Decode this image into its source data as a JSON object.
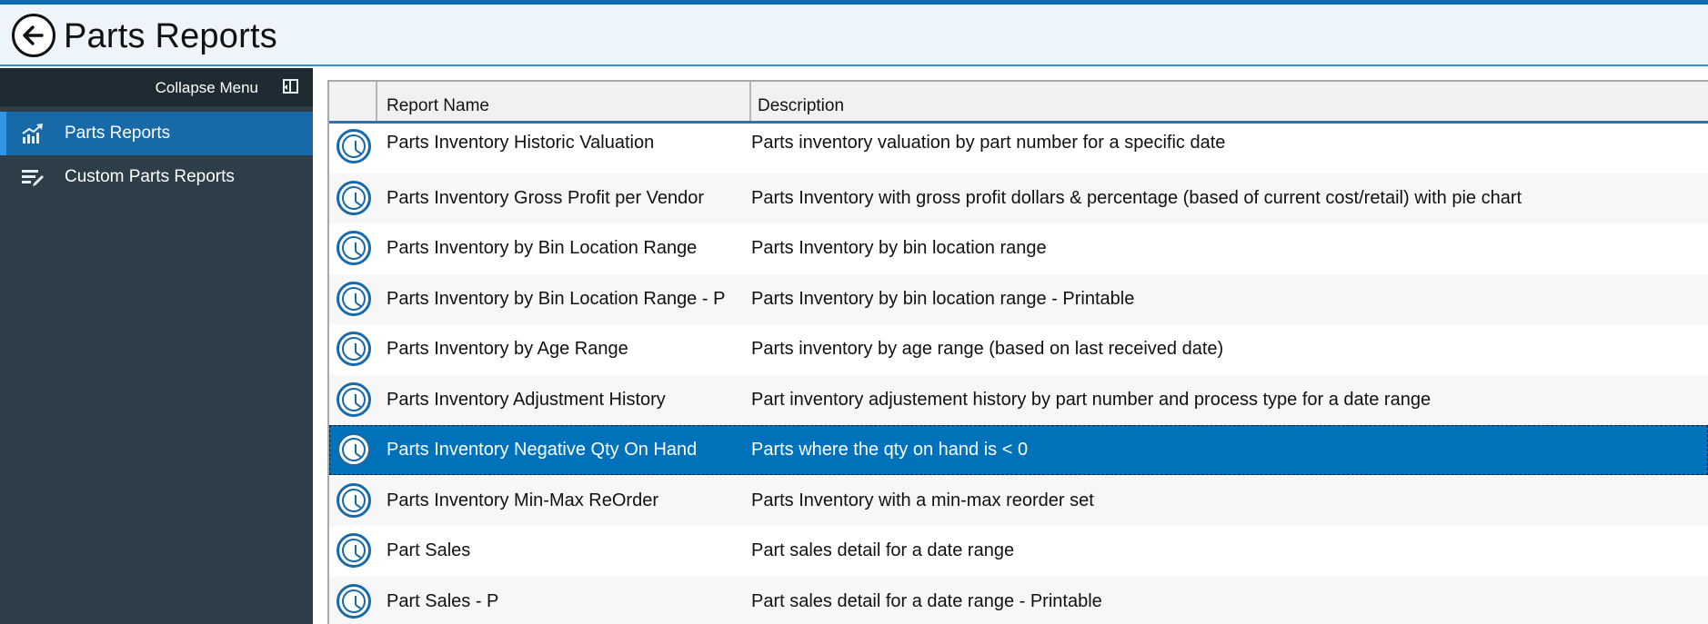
{
  "header": {
    "title": "Parts Reports",
    "back_icon": "back-arrow-icon"
  },
  "sidebar": {
    "collapse_label": "Collapse Menu",
    "collapse_icon": "collapse-menu-icon",
    "items": [
      {
        "label": "Parts Reports",
        "icon": "chart-trend-icon",
        "active": true
      },
      {
        "label": "Custom Parts Reports",
        "icon": "list-edit-icon",
        "active": false
      }
    ]
  },
  "grid": {
    "columns": [
      "",
      "Report Name",
      "Description"
    ],
    "row_icon": "clock-icon",
    "rows": [
      {
        "name": "Parts Inventory Historic Valuation",
        "description": "Parts inventory valuation by part number for a specific date"
      },
      {
        "name": "Parts Inventory Gross Profit per Vendor",
        "description": "Parts Inventory with gross profit dollars & percentage (based of current cost/retail) with pie chart"
      },
      {
        "name": "Parts Inventory by Bin Location Range",
        "description": "Parts Inventory by bin location range"
      },
      {
        "name": "Parts Inventory by Bin Location Range - P",
        "description": "Parts Inventory by bin location range - Printable"
      },
      {
        "name": "Parts Inventory by Age Range",
        "description": "Parts inventory by age range (based on last received date)"
      },
      {
        "name": "Parts Inventory Adjustment History",
        "description": "Part inventory adjustement history by part number and process type for a date range"
      },
      {
        "name": "Parts Inventory Negative Qty On Hand",
        "description": "Parts where the qty on hand is < 0",
        "selected": true
      },
      {
        "name": "Parts Inventory Min-Max ReOrder",
        "description": "Parts Inventory with a min-max reorder set"
      },
      {
        "name": "Part Sales",
        "description": "Part sales detail for a date range"
      },
      {
        "name": "Part Sales - P",
        "description": "Part sales detail for a date range - Printable"
      }
    ]
  },
  "colors": {
    "accent": "#0e6bb0",
    "selected_row": "#0072bc",
    "sidebar_bg": "#2d3e48",
    "sidebar_active": "#176aa7"
  }
}
